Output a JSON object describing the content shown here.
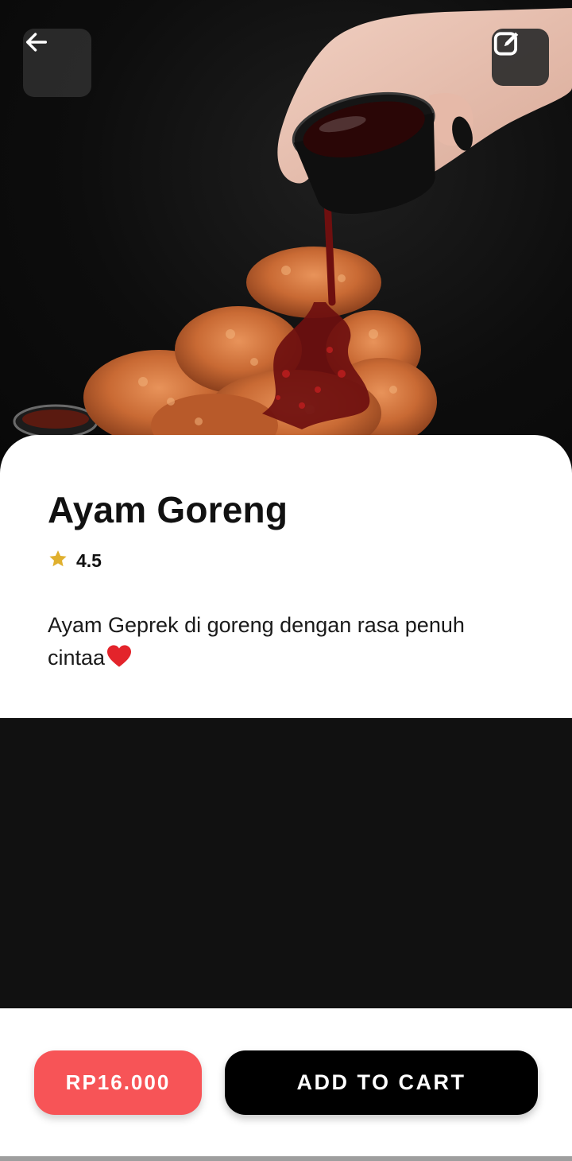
{
  "header": {
    "back_icon": "arrow-left-icon",
    "edit_icon": "edit-square-icon"
  },
  "hero": {
    "image": "fried-chicken-with-sauce-photo"
  },
  "product": {
    "name": "Ayam Goreng",
    "rating": "4.5",
    "rating_icon": "star-icon",
    "description": "Ayam Geprek di goreng dengan rasa penuh cintaa",
    "description_emoji": "heart-icon"
  },
  "actions": {
    "price_label": "RP16.000",
    "add_to_cart_label": "ADD TO CART"
  },
  "colors": {
    "price_button": "#f75457",
    "cart_button": "#000000",
    "star": "#e0b02e",
    "dark_background": "#111111"
  }
}
